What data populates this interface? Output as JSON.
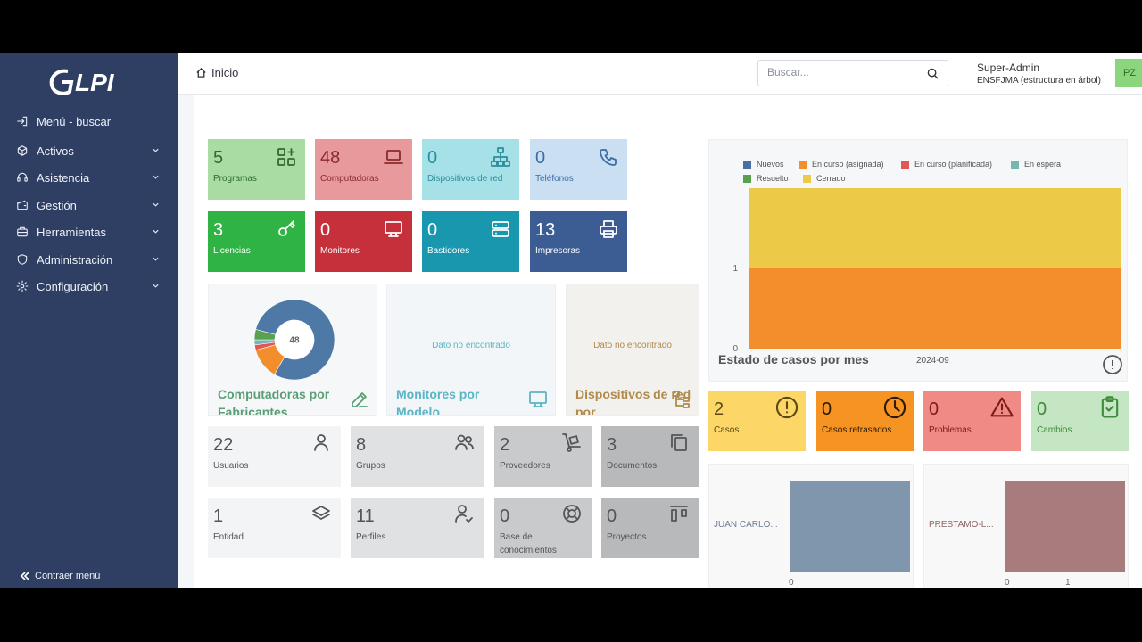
{
  "app": {
    "logo_text": "GLPI"
  },
  "sidebar": {
    "items": [
      {
        "label": "Menú - buscar",
        "icon": "sign-in-icon",
        "has_chevron": false
      },
      {
        "label": "Activos",
        "icon": "box-icon",
        "has_chevron": true
      },
      {
        "label": "Asistencia",
        "icon": "headset-icon",
        "has_chevron": true
      },
      {
        "label": "Gestión",
        "icon": "wallet-icon",
        "has_chevron": true
      },
      {
        "label": "Herramientas",
        "icon": "briefcase-icon",
        "has_chevron": true
      },
      {
        "label": "Administración",
        "icon": "shield-icon",
        "has_chevron": true
      },
      {
        "label": "Configuración",
        "icon": "gear-icon",
        "has_chevron": true
      }
    ],
    "collapse_label": "Contraer menú"
  },
  "header": {
    "breadcrumb": "Inicio",
    "search_placeholder": "Buscar...",
    "user_name": "Super-Admin",
    "user_entity": "ENSFJMA (estructura en árbol)",
    "avatar_initials": "PZ"
  },
  "asset_tiles": [
    {
      "value": "5",
      "label": "Programas",
      "icon": "apps-icon",
      "bg": "#a8dca2",
      "fg": "#2f6b2a"
    },
    {
      "value": "48",
      "label": "Computadoras",
      "icon": "laptop-icon",
      "bg": "#e8999b",
      "fg": "#8a2a2e"
    },
    {
      "value": "0",
      "label": "Dispositivos de red",
      "icon": "network-icon",
      "bg": "#a7e1e8",
      "fg": "#2b8d9b"
    },
    {
      "value": "0",
      "label": "Teléfonos",
      "icon": "phone-icon",
      "bg": "#cbdff3",
      "fg": "#3a6ea5"
    },
    {
      "value": "3",
      "label": "Licencias",
      "icon": "key-icon",
      "bg": "#2fb344",
      "fg": "#ffffff"
    },
    {
      "value": "0",
      "label": "Monitores",
      "icon": "monitor-icon",
      "bg": "#c5303b",
      "fg": "#ffffff"
    },
    {
      "value": "0",
      "label": "Bastidores",
      "icon": "server-icon",
      "bg": "#1997ae",
      "fg": "#ffffff"
    },
    {
      "value": "13",
      "label": "Impresoras",
      "icon": "printer-icon",
      "bg": "#3b5d94",
      "fg": "#ffffff"
    }
  ],
  "panels": [
    {
      "title": "Computadoras por Fabricantes",
      "icon": "edit-icon",
      "center_value": "48",
      "color": "#5a9e75"
    },
    {
      "title": "Monitores por Modelo",
      "icon": "monitor-icon",
      "no_data": "Dato no encontrado",
      "color": "#5ab5c4"
    },
    {
      "title": "Dispositivos de red por",
      "icon": "sitemap-icon",
      "no_data": "Dato no encontrado",
      "color": "#b08a4a"
    }
  ],
  "admin_tiles": [
    {
      "value": "22",
      "label": "Usuarios",
      "icon": "user-icon",
      "bg": "#f3f4f6"
    },
    {
      "value": "8",
      "label": "Grupos",
      "icon": "users-icon",
      "bg": "#e0e1e3"
    },
    {
      "value": "2",
      "label": "Proveedores",
      "icon": "dolly-icon",
      "bg": "#c9cacc"
    },
    {
      "value": "3",
      "label": "Documentos",
      "icon": "files-icon",
      "bg": "#b8b9bb"
    },
    {
      "value": "1",
      "label": "Entidad",
      "icon": "layers-icon",
      "bg": "#f3f4f6"
    },
    {
      "value": "11",
      "label": "Perfiles",
      "icon": "user-check-icon",
      "bg": "#e0e1e3"
    },
    {
      "value": "0",
      "label": "Base de conocimientos",
      "icon": "lifebuoy-icon",
      "bg": "#c9cacc"
    },
    {
      "value": "0",
      "label": "Proyectos",
      "icon": "kanban-icon",
      "bg": "#b8b9bb"
    }
  ],
  "ticket_tiles": [
    {
      "value": "2",
      "label": "Casos",
      "icon": "alert-circle-icon",
      "bg": "#fcd667",
      "fg": "#5a4a10"
    },
    {
      "value": "0",
      "label": "Casos retrasados",
      "icon": "clock-icon",
      "bg": "#f59423",
      "fg": "#2a1a05"
    },
    {
      "value": "0",
      "label": "Problemas",
      "icon": "alert-triangle-icon",
      "bg": "#f08a85",
      "fg": "#7a1d1a"
    },
    {
      "value": "0",
      "label": "Cambios",
      "icon": "clipboard-check-icon",
      "bg": "#c4e6c3",
      "fg": "#3f8a3c"
    }
  ],
  "mini_charts": [
    {
      "label": "JUAN CARLO...",
      "color": "#8096ad",
      "label_color": "#6a7d92",
      "ticks": [
        "0"
      ]
    },
    {
      "label": "PRESTAMO-L...",
      "color": "#a87c7c",
      "label_color": "#8e6464",
      "ticks": [
        "0",
        "1"
      ]
    }
  ],
  "chart_data": [
    {
      "type": "bar",
      "title": "Estado de casos por mes",
      "categories": [
        "2024-09"
      ],
      "stacked": true,
      "ylim": [
        0,
        2
      ],
      "yticks": [
        "0",
        "1"
      ],
      "legend_position": "top-left",
      "series": [
        {
          "name": "Nuevos",
          "color": "#4a6fa5",
          "values": [
            0
          ]
        },
        {
          "name": "En curso (asignada)",
          "color": "#f28e2b",
          "values": [
            1
          ]
        },
        {
          "name": "En curso (planificada)",
          "color": "#e15759",
          "values": [
            0
          ]
        },
        {
          "name": "En espera",
          "color": "#76b7b2",
          "values": [
            0
          ]
        },
        {
          "name": "Resuelto",
          "color": "#59a14f",
          "values": [
            0
          ]
        },
        {
          "name": "Cerrado",
          "color": "#edc948",
          "values": [
            1
          ]
        }
      ]
    },
    {
      "type": "pie",
      "title": "Computadoras por Fabricantes",
      "total": 48,
      "slices": [
        {
          "value": 38,
          "color": "#4e79a7"
        },
        {
          "value": 6,
          "color": "#f28e2b"
        },
        {
          "value": 1,
          "color": "#e15759"
        },
        {
          "value": 1,
          "color": "#76b7b2"
        },
        {
          "value": 2,
          "color": "#59a14f"
        }
      ]
    }
  ]
}
